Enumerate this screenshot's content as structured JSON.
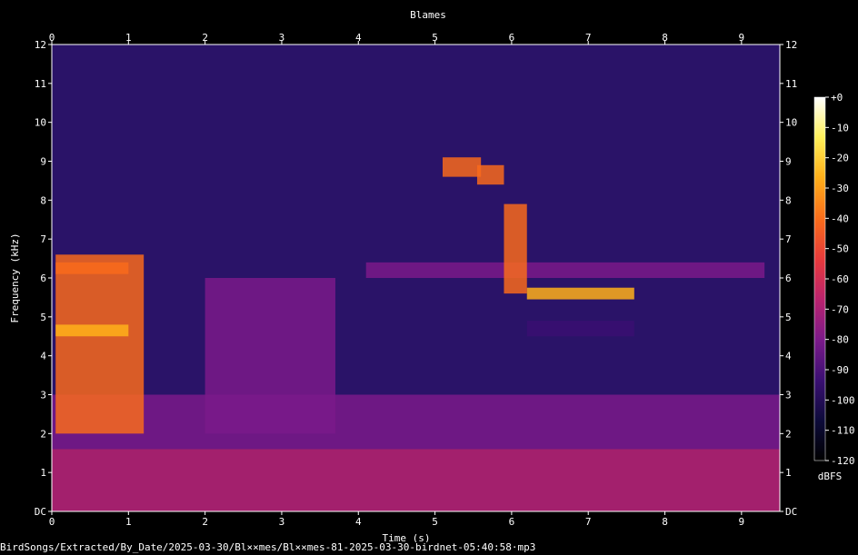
{
  "chart_data": {
    "type": "heatmap",
    "title": "Blames",
    "xlabel": "Time (s)",
    "ylabel": "Frequency (kHz)",
    "xlim": [
      0,
      9.5
    ],
    "ylim": [
      0,
      12
    ],
    "x_ticks": [
      0,
      1,
      2,
      3,
      4,
      5,
      6,
      7,
      8,
      9
    ],
    "y_ticks": [
      "DC",
      "1",
      "2",
      "3",
      "4",
      "5",
      "6",
      "7",
      "8",
      "9",
      "10",
      "11",
      "12"
    ],
    "colorbar": {
      "unit": "dBFS",
      "range": [
        -120,
        0
      ],
      "ticks": [
        "+0",
        "-10",
        "-20",
        "-30",
        "-40",
        "-50",
        "-60",
        "-70",
        "-80",
        "-90",
        "-100",
        "-110",
        "-120"
      ],
      "colors": [
        "#000000",
        "#0d0b3a",
        "#3a0f72",
        "#7a1a8a",
        "#b8236f",
        "#e5393d",
        "#f86a1c",
        "#ffb01a",
        "#fff05a",
        "#ffffff"
      ]
    },
    "grid": false,
    "grid_cells": {
      "time_bins": 95,
      "freq_bins": 60,
      "frames": [
        {
          "t": [
            0.05,
            1.2
          ],
          "f": [
            2.0,
            6.6
          ],
          "level": -45
        },
        {
          "t": [
            0.05,
            1.0
          ],
          "f": [
            4.5,
            4.8
          ],
          "level": -25
        },
        {
          "t": [
            0.05,
            1.0
          ],
          "f": [
            6.1,
            6.4
          ],
          "level": -45
        },
        {
          "t": [
            5.1,
            5.6
          ],
          "f": [
            8.6,
            9.1
          ],
          "level": -35
        },
        {
          "t": [
            5.55,
            5.9
          ],
          "f": [
            8.4,
            8.9
          ],
          "level": -35
        },
        {
          "t": [
            5.9,
            6.2
          ],
          "f": [
            5.6,
            7.9
          ],
          "level": -40
        },
        {
          "t": [
            6.2,
            7.6
          ],
          "f": [
            5.45,
            5.75
          ],
          "level": -30
        },
        {
          "t": [
            4.1,
            9.3
          ],
          "f": [
            6.0,
            6.4
          ],
          "level": -80
        },
        {
          "t": [
            6.2,
            7.6
          ],
          "f": [
            4.5,
            4.9
          ],
          "level": -95
        },
        {
          "t": [
            2.0,
            3.7
          ],
          "f": [
            2.0,
            6.0
          ],
          "level": -75
        },
        {
          "t": [
            0.0,
            9.5
          ],
          "f": [
            0.0,
            1.6
          ],
          "level": -65
        },
        {
          "t": [
            0.0,
            9.5
          ],
          "f": [
            1.6,
            3.0
          ],
          "level": -80
        }
      ]
    }
  },
  "footer_path": "BirdSongs/Extracted/By_Date/2025-03-30/Bl××mes/Bl××mes-81-2025-03-30-birdnet-05:40:58·mp3"
}
